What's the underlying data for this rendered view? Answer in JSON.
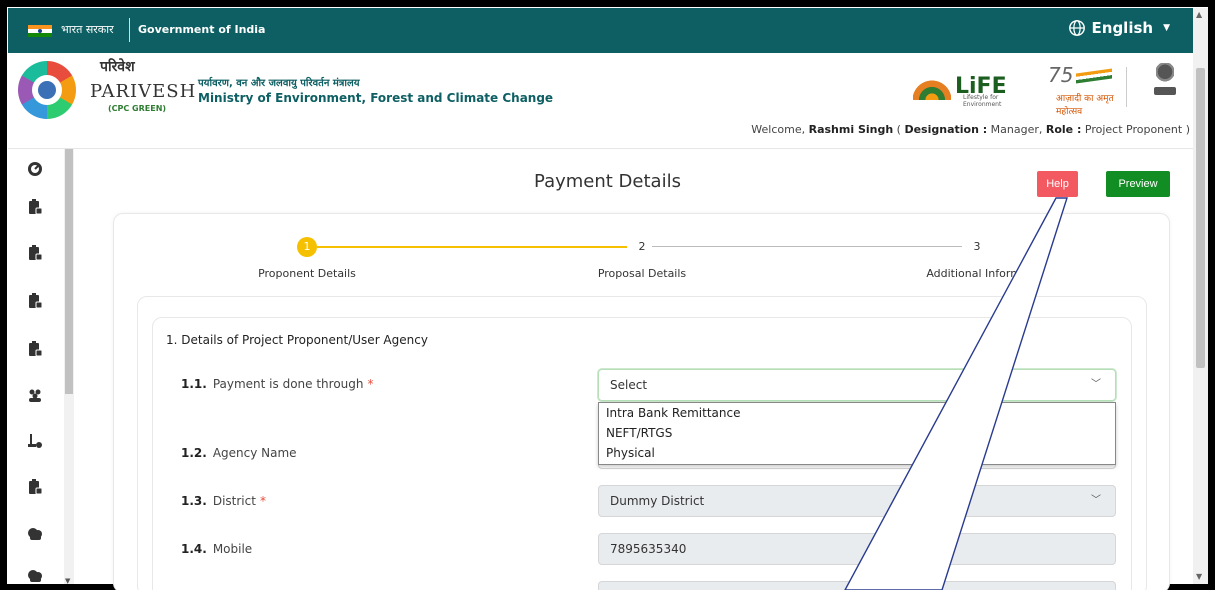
{
  "gov_bar": {
    "hindi": "भारत सरकार",
    "english": "Government of India",
    "language": "English"
  },
  "header": {
    "logo_hindi": "परिवेश",
    "logo_english": "PARIVESH",
    "logo_sub": "(CPC GREEN)",
    "ministry_hindi": "पर्यावरण, वन और जलवायु परिवर्तन मंत्रालय",
    "ministry_english": "Ministry of Environment, Forest and Climate Change",
    "life_logo": "LiFE",
    "life_sub": "Lifestyle for Environment",
    "azadi_num": "75",
    "azadi_text": "आज़ादी का अमृत महोत्सव",
    "welcome_prefix": "Welcome, ",
    "user_name": "Rashmi Singh",
    "designation_label": "Designation :",
    "designation": "Manager",
    "role_label": "Role :",
    "role": "Project Proponent"
  },
  "sidebar": {
    "icons": [
      "dashboard-icon",
      "clipboard-icon",
      "clipboard-icon",
      "clipboard-icon",
      "clipboard-icon",
      "users-icon",
      "user-icon",
      "clipboard-icon",
      "cloud-icon",
      "cloud-icon"
    ]
  },
  "page": {
    "title": "Payment Details",
    "help": "Help",
    "preview": "Preview"
  },
  "stepper": {
    "steps": [
      {
        "number": "1",
        "label": "Proponent Details"
      },
      {
        "number": "2",
        "label": "Proposal Details"
      },
      {
        "number": "3",
        "label": "Additional Informa"
      }
    ]
  },
  "form": {
    "section_title": "1.  Details of Project Proponent/User Agency",
    "fields": [
      {
        "num": "1.1.",
        "label": "Payment is done through",
        "required": "*",
        "value": "Select"
      },
      {
        "num": "1.2.",
        "label": "Agency Name",
        "value": ""
      },
      {
        "num": "1.3.",
        "label": "District",
        "required": "*",
        "value": "Dummy District"
      },
      {
        "num": "1.4.",
        "label": "Mobile",
        "value": "7895635340"
      }
    ],
    "dropdown_options": [
      "Intra Bank Remittance",
      "NEFT/RTGS",
      "Physical"
    ]
  },
  "colors": {
    "gov_bar": "#0d5f63",
    "help": "#f25961",
    "preview": "#128d23",
    "step_active": "#f5c000"
  }
}
